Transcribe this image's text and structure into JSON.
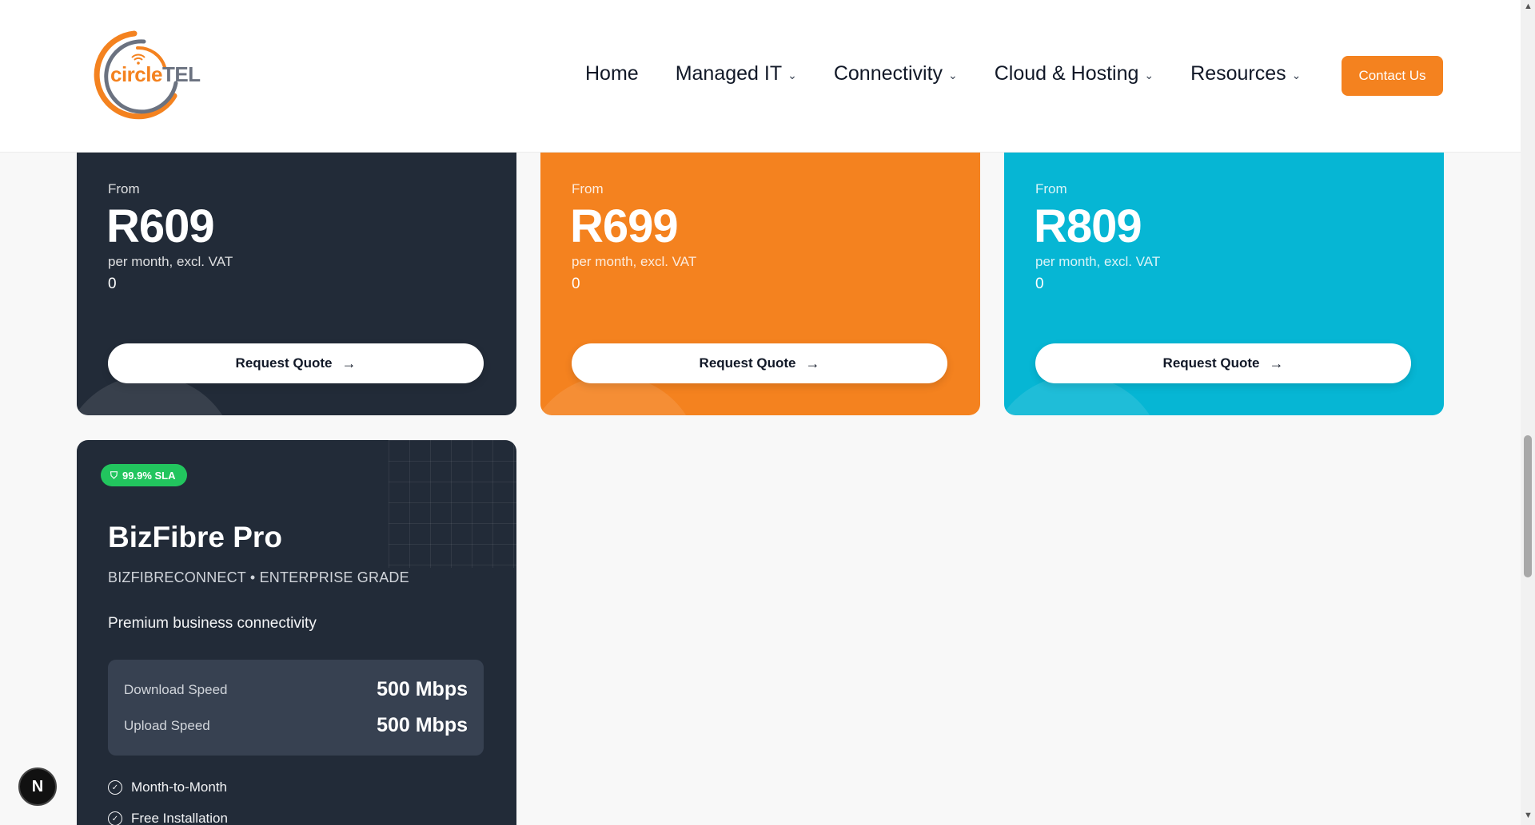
{
  "header": {
    "logo": {
      "brand_circle": "circle",
      "brand_tel": "TEL"
    },
    "nav": [
      {
        "label": "Home",
        "has_dropdown": false
      },
      {
        "label": "Managed IT",
        "has_dropdown": true
      },
      {
        "label": "Connectivity",
        "has_dropdown": true
      },
      {
        "label": "Cloud & Hosting",
        "has_dropdown": true
      },
      {
        "label": "Resources",
        "has_dropdown": true
      }
    ],
    "contact_label": "Contact Us"
  },
  "plans": [
    {
      "from_label": "From",
      "price": "R609",
      "period": "per month, excl. VAT",
      "extra": "0",
      "cta": "Request Quote",
      "color": "#222b38"
    },
    {
      "from_label": "From",
      "price": "R699",
      "period": "per month, excl. VAT",
      "extra": "0",
      "cta": "Request Quote",
      "color": "#f4821f"
    },
    {
      "from_label": "From",
      "price": "R809",
      "period": "per month, excl. VAT",
      "extra": "0",
      "cta": "Request Quote",
      "color": "#06b6d4"
    }
  ],
  "pro": {
    "badge": "99.9% SLA",
    "title": "BizFibre Pro",
    "subtitle": "BIZFIBRECONNECT • ENTERPRISE GRADE",
    "description": "Premium business connectivity",
    "speeds": [
      {
        "label": "Download Speed",
        "value": "500 Mbps"
      },
      {
        "label": "Upload Speed",
        "value": "500 Mbps"
      }
    ],
    "features": [
      "Month-to-Month",
      "Free Installation"
    ]
  },
  "dev_badge": "N",
  "colors": {
    "accent": "#f4821f",
    "dark": "#222b38",
    "cyan": "#06b6d4",
    "sla_green": "#22c55e"
  }
}
